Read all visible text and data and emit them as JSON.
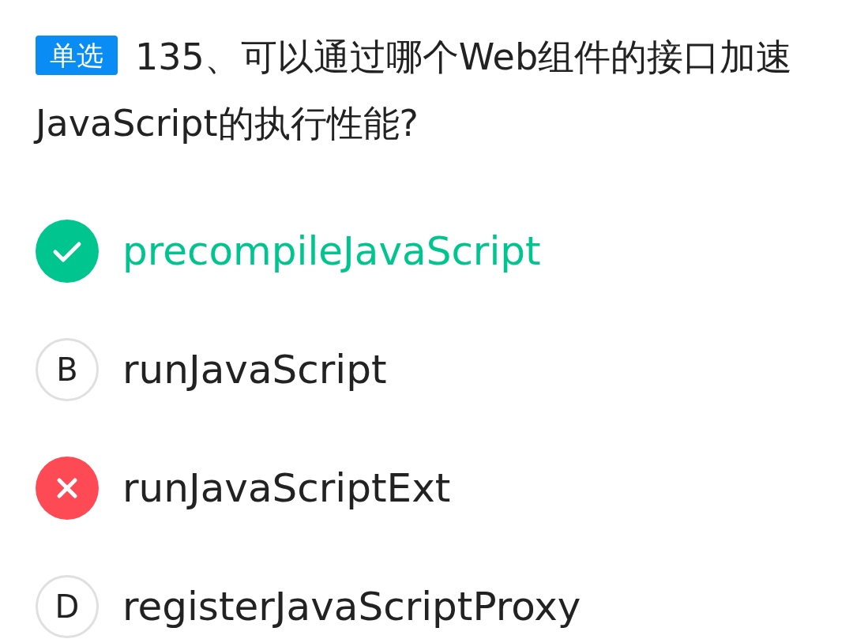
{
  "question": {
    "tag": "单选",
    "text": "135、可以通过哪个Web组件的接口加速JavaScript的执行性能?"
  },
  "options": [
    {
      "kind": "correct",
      "text": "precompileJavaScript"
    },
    {
      "kind": "plain",
      "letter": "B",
      "text": "runJavaScript"
    },
    {
      "kind": "wrong",
      "text": "runJavaScriptExt"
    },
    {
      "kind": "plain",
      "letter": "D",
      "text": "registerJavaScriptProxy"
    }
  ]
}
